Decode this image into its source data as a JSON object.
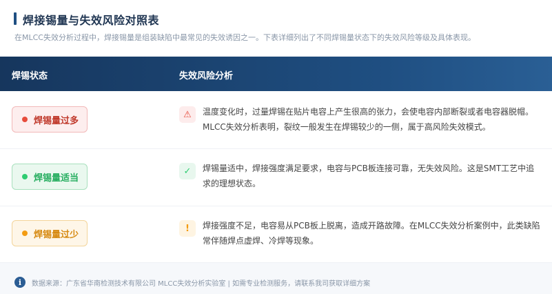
{
  "header": {
    "title": "焊接锡量与失效风险对照表",
    "subtitle": "在MLCC失效分析过程中，焊接锡量是组装缺陷中最常见的失效诱因之一。下表详细列出了不同焊锡量状态下的失效风险等级及具体表现。"
  },
  "table": {
    "columns": [
      "焊锡状态",
      "失效风险分析"
    ],
    "rows": [
      {
        "status": "焊锡量过多",
        "status_color": "#e74c3c",
        "icon": "warning-icon",
        "icon_glyph": "⚠",
        "analysis": "温度变化时，过量焊锡在贴片电容上产生很高的张力，会使电容内部断裂或者电容器脱帽。MLCC失效分析表明，裂纹一般发生在焊锡较少的一侧，属于高风险失效模式。"
      },
      {
        "status": "焊锡量适当",
        "status_color": "#2ecc71",
        "icon": "check-icon",
        "icon_glyph": "✓",
        "analysis": "焊锡量适中，焊接强度满足要求，电容与PCB板连接可靠，无失效风险。这是SMT工艺中追求的理想状态。"
      },
      {
        "status": "焊锡量过少",
        "status_color": "#f39c12",
        "icon": "exclamation-icon",
        "icon_glyph": "!",
        "analysis": "焊接强度不足，电容易从PCB板上脱离，造成开路故障。在MLCC失效分析案例中，此类缺陷常伴随焊点虚焊、冷焊等现象。"
      }
    ]
  },
  "footer": {
    "icon_glyph": "i",
    "text": "数据来源：广东省华南检测技术有限公司 MLCC失效分析实验室 | 如需专业检测服务，请联系我司获取详细方案"
  }
}
